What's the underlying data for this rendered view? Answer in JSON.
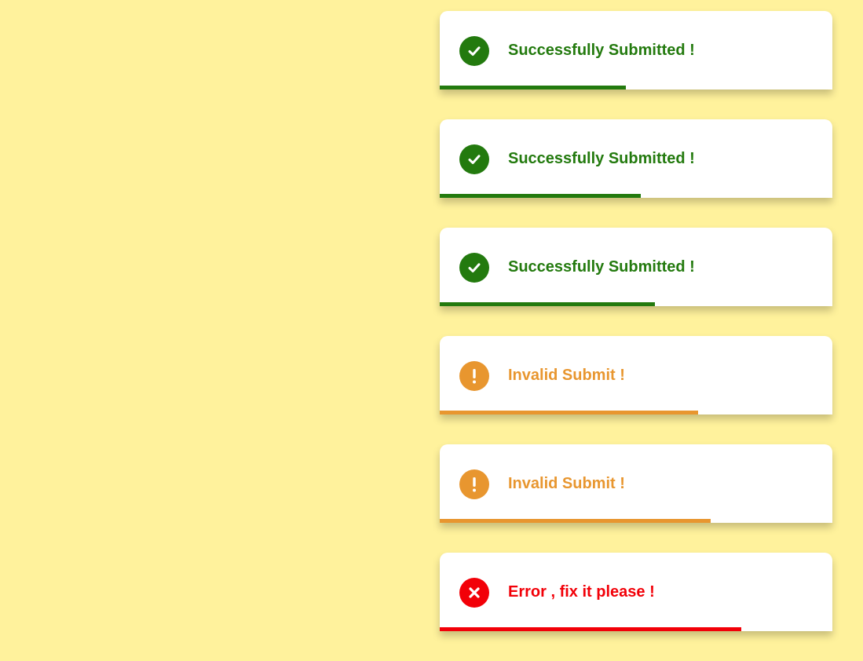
{
  "colors": {
    "background": "#fff29c",
    "success": "#237a0e",
    "warning": "#e8962f",
    "error": "#f20008"
  },
  "toasts": [
    {
      "type": "success",
      "icon": "check-circle-icon",
      "message": "Successfully Submitted !",
      "progress": 0.474
    },
    {
      "type": "success",
      "icon": "check-circle-icon",
      "message": "Successfully Submitted !",
      "progress": 0.512
    },
    {
      "type": "success",
      "icon": "check-circle-icon",
      "message": "Successfully Submitted !",
      "progress": 0.548
    },
    {
      "type": "warning",
      "icon": "exclamation-circle-icon",
      "message": "Invalid Submit !",
      "progress": 0.658
    },
    {
      "type": "warning",
      "icon": "exclamation-circle-icon",
      "message": "Invalid Submit !",
      "progress": 0.69
    },
    {
      "type": "error",
      "icon": "x-circle-icon",
      "message": "Error , fix it please !",
      "progress": 0.768
    }
  ]
}
